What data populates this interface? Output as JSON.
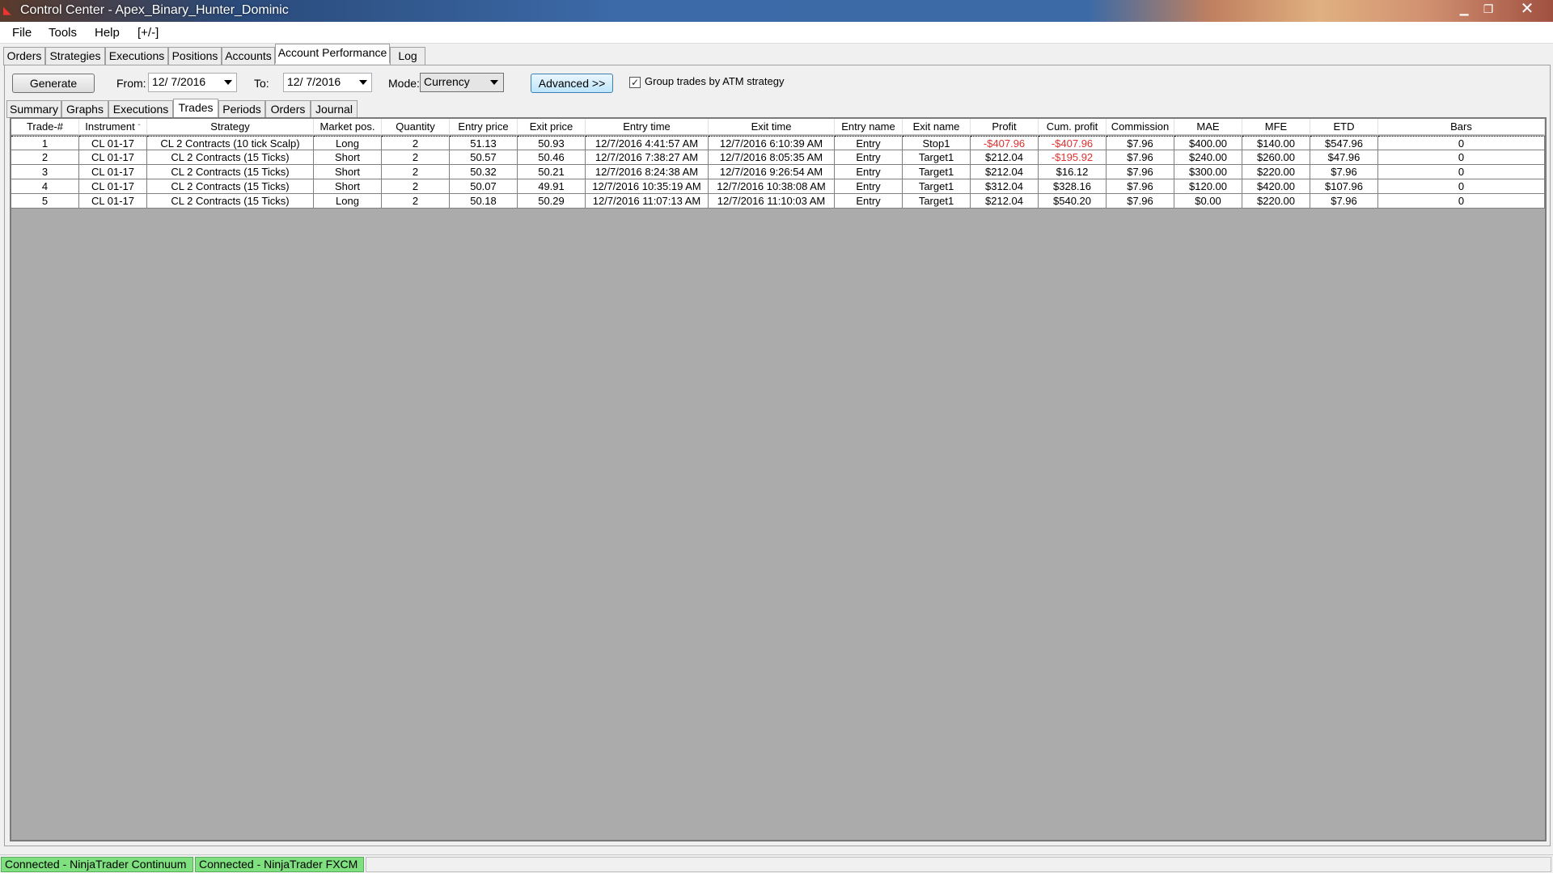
{
  "window": {
    "title": "Control Center - Apex_Binary_Hunter_Dominic"
  },
  "menu": [
    "File",
    "Tools",
    "Help",
    "[+/-]"
  ],
  "top_tabs": [
    "Orders",
    "Strategies",
    "Executions",
    "Positions",
    "Accounts",
    "Account Performance",
    "Log"
  ],
  "controls": {
    "generate": "Generate",
    "from_label": "From:",
    "from_value": "12/  7/2016",
    "to_label": "To:",
    "to_value": "12/  7/2016",
    "mode_label": "Mode:",
    "mode_value": "Currency",
    "advanced": "Advanced >>",
    "group_label": "Group trades by ATM strategy",
    "group_checked": true
  },
  "sub_tabs": [
    "Summary",
    "Graphs",
    "Executions",
    "Trades",
    "Periods",
    "Orders",
    "Journal"
  ],
  "columns": [
    "Trade-#",
    "Instrument",
    "Strategy",
    "Market pos.",
    "Quantity",
    "Entry price",
    "Exit price",
    "Entry time",
    "Exit time",
    "Entry name",
    "Exit name",
    "Profit",
    "Cum. profit",
    "Commission",
    "MAE",
    "MFE",
    "ETD",
    "Bars"
  ],
  "sort_indicator": "ˆ",
  "rows": [
    [
      "1",
      "CL 01-17",
      "CL 2 Contracts (10 tick Scalp)",
      "Long",
      "2",
      "51.13",
      "50.93",
      "12/7/2016 4:41:57 AM",
      "12/7/2016 6:10:39 AM",
      "Entry",
      "Stop1",
      "-$407.96",
      "-$407.96",
      "$7.96",
      "$400.00",
      "$140.00",
      "$547.96",
      "0"
    ],
    [
      "2",
      "CL 01-17",
      "CL 2 Contracts (15 Ticks)",
      "Short",
      "2",
      "50.57",
      "50.46",
      "12/7/2016 7:38:27 AM",
      "12/7/2016 8:05:35 AM",
      "Entry",
      "Target1",
      "$212.04",
      "-$195.92",
      "$7.96",
      "$240.00",
      "$260.00",
      "$47.96",
      "0"
    ],
    [
      "3",
      "CL 01-17",
      "CL 2 Contracts (15 Ticks)",
      "Short",
      "2",
      "50.32",
      "50.21",
      "12/7/2016 8:24:38 AM",
      "12/7/2016 9:26:54 AM",
      "Entry",
      "Target1",
      "$212.04",
      "$16.12",
      "$7.96",
      "$300.00",
      "$220.00",
      "$7.96",
      "0"
    ],
    [
      "4",
      "CL 01-17",
      "CL 2 Contracts (15 Ticks)",
      "Short",
      "2",
      "50.07",
      "49.91",
      "12/7/2016 10:35:19 AM",
      "12/7/2016 10:38:08 AM",
      "Entry",
      "Target1",
      "$312.04",
      "$328.16",
      "$7.96",
      "$120.00",
      "$420.00",
      "$107.96",
      "0"
    ],
    [
      "5",
      "CL 01-17",
      "CL 2 Contracts (15 Ticks)",
      "Long",
      "2",
      "50.18",
      "50.29",
      "12/7/2016 11:07:13 AM",
      "12/7/2016 11:10:03 AM",
      "Entry",
      "Target1",
      "$212.04",
      "$540.20",
      "$7.96",
      "$0.00",
      "$220.00",
      "$7.96",
      "0"
    ]
  ],
  "status": [
    "Connected - NinjaTrader Continuum",
    "Connected - NinjaTrader FXCM"
  ],
  "colors": {
    "negative": "#e03030",
    "connected": "#7fe07f"
  }
}
